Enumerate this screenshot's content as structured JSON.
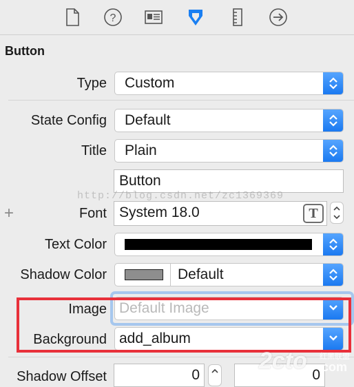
{
  "panel": {
    "tabs": [
      {
        "icon": "file-inspector-icon"
      },
      {
        "icon": "quick-help-icon"
      },
      {
        "icon": "identity-inspector-icon"
      },
      {
        "icon": "attributes-inspector-icon",
        "selected": true
      },
      {
        "icon": "size-inspector-icon"
      },
      {
        "icon": "connections-inspector-icon"
      }
    ],
    "accent": "#1a7ff2",
    "highlight_color": "#e8303a"
  },
  "section": {
    "title": "Button"
  },
  "fields": {
    "type": {
      "label": "Type",
      "value": "Custom"
    },
    "state_config": {
      "label": "State Config",
      "value": "Default"
    },
    "title": {
      "label": "Title",
      "value": "Plain"
    },
    "title_text": {
      "value": "Button"
    },
    "font": {
      "add": "+",
      "label": "Font",
      "value": "System 18.0",
      "button": "T"
    },
    "text_color": {
      "label": "Text Color",
      "swatch": "#000000"
    },
    "shadow_color": {
      "label": "Shadow Color",
      "swatch": "#8e8e8e",
      "value": "Default"
    },
    "image": {
      "label": "Image",
      "placeholder": "Default Image"
    },
    "background": {
      "label": "Background",
      "value": "add_album"
    },
    "shadow_offset": {
      "label": "Shadow Offset",
      "x": "0",
      "y": "0"
    }
  },
  "watermarks": {
    "blog": "http://blog.csdn.net/zc1369369",
    "site": "2cto",
    "site_suffix": ".com",
    "site_cn": "红黑联盟"
  }
}
